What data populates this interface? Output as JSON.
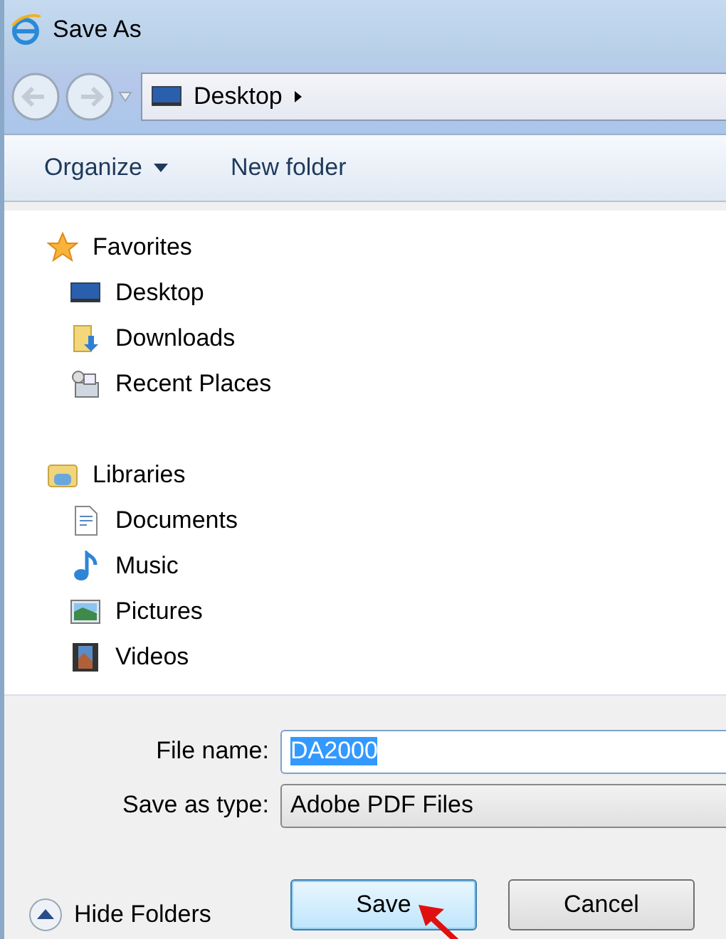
{
  "window": {
    "title": "Save As"
  },
  "address": {
    "crumbs": [
      "Desktop"
    ]
  },
  "toolbar": {
    "organize": "Organize",
    "new_folder": "New folder"
  },
  "sidebar": {
    "groups": [
      {
        "label": "Favorites",
        "kind": "star",
        "children": [
          {
            "label": "Desktop",
            "kind": "desktop"
          },
          {
            "label": "Downloads",
            "kind": "downloads"
          },
          {
            "label": "Recent Places",
            "kind": "recent"
          }
        ]
      },
      {
        "label": "Libraries",
        "kind": "libraries",
        "children": [
          {
            "label": "Documents",
            "kind": "documents"
          },
          {
            "label": "Music",
            "kind": "music"
          },
          {
            "label": "Pictures",
            "kind": "pictures"
          },
          {
            "label": "Videos",
            "kind": "videos"
          }
        ]
      }
    ]
  },
  "form": {
    "fields": [
      {
        "label": "File name:",
        "value": "DA2000",
        "kind": "text",
        "text_highlighted": true
      },
      {
        "label": "Save as type:",
        "value": "Adobe PDF Files",
        "kind": "select",
        "text_highlighted": false
      }
    ]
  },
  "hide_folders": "Hide Folders",
  "buttons": [
    {
      "label": "Save",
      "default": true,
      "annotated": true
    },
    {
      "label": "Cancel",
      "default": false,
      "annotated": false
    }
  ]
}
